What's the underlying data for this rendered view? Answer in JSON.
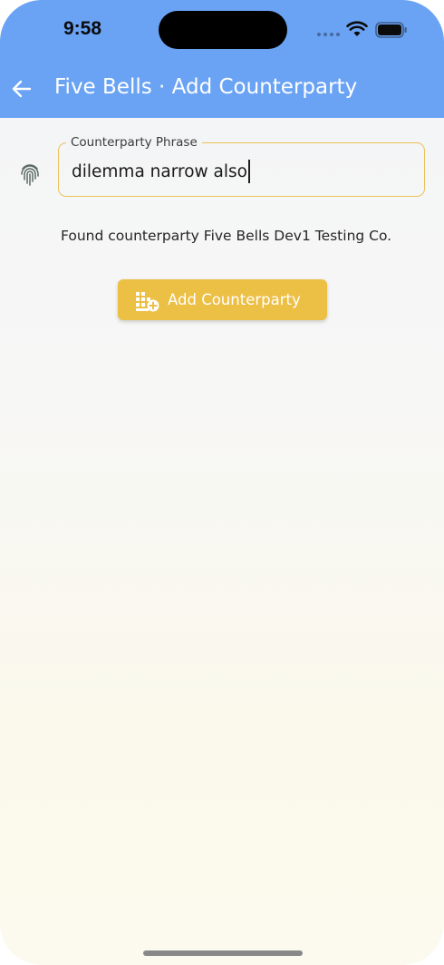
{
  "status_bar": {
    "time": "9:58"
  },
  "app_bar": {
    "back_icon": "arrow-left-icon",
    "title": "Five Bells · Add Counterparty"
  },
  "form": {
    "leading_icon": "fingerprint-icon",
    "phrase_field": {
      "label": "Counterparty Phrase",
      "value": "dilemma narrow also"
    },
    "found_message": "Found counterparty Five Bells Dev1 Testing Co.",
    "add_button": {
      "icon": "building-add-icon",
      "label": "Add Counterparty"
    }
  },
  "colors": {
    "app_bar": "#6aa3f4",
    "accent": "#ecbf45",
    "field_border": "#e9c25a"
  }
}
